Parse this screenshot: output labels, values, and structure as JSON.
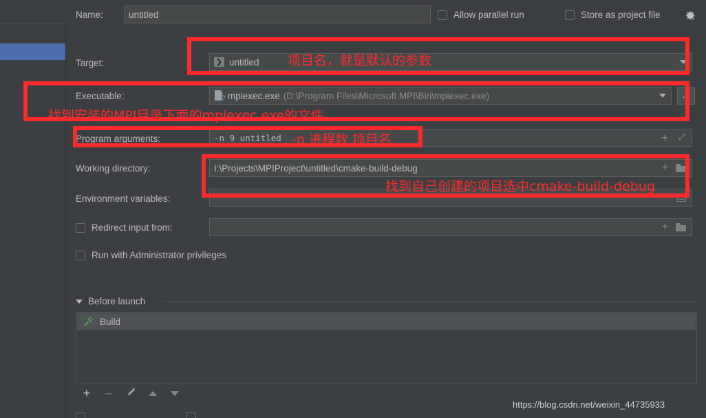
{
  "window": {
    "theme_bg": "#3c3f41",
    "accent_selection": "#4b6eaf",
    "annotation_color": "#ff2a2a"
  },
  "form": {
    "name": {
      "label": "Name:",
      "value": "untitled"
    },
    "allow_parallel_run": {
      "label": "Allow parallel run",
      "checked": false
    },
    "store_as_project_file": {
      "label": "Store as project file",
      "checked": false
    },
    "gear_icon": "gear-icon",
    "target": {
      "label": "Target:",
      "value": "untitled",
      "icon": "run-configuration-icon"
    },
    "executable": {
      "label": "Executable:",
      "value": "mpiexec.exe",
      "path": "(D:\\Program Files\\Microsoft MPI\\Bin\\mpiexec.exe)",
      "icon": "unknown-file-icon",
      "browse_label": "..."
    },
    "program_arguments": {
      "label": "Program arguments:",
      "value": "-n 9 untitled",
      "expand_icon": "expand-icon",
      "insert_icon": "insert-macro-icon"
    },
    "working_directory": {
      "label": "Working directory:",
      "value": "I:\\Projects\\MPIProject\\untitled\\cmake-build-debug",
      "folder_icon": "folder-icon",
      "insert_icon": "insert-macro-icon"
    },
    "environment_variables": {
      "label": "Environment variables:",
      "value": "",
      "browse_icon": "env-browse-icon"
    },
    "redirect_input_from": {
      "label": "Redirect input from:",
      "checked": false,
      "value": "",
      "folder_icon": "folder-icon",
      "insert_icon": "insert-macro-icon"
    },
    "run_with_admin": {
      "label": "Run with Administrator privileges",
      "checked": false
    }
  },
  "before_launch": {
    "title": "Before launch",
    "collapse_icon": "triangle-down-icon",
    "items": [
      {
        "label": "Build",
        "icon": "hammer-icon"
      }
    ],
    "toolbar": {
      "add": "+",
      "remove": "–",
      "edit": "pencil-icon",
      "move_up": "triangle-up-icon",
      "move_down": "triangle-down-icon"
    }
  },
  "annotations": [
    {
      "id": "target-note",
      "text": "项目名，就是默认的参数"
    },
    {
      "id": "executable-note",
      "text": "找到安装的MPI目录下面的mpiexec.exe的文件"
    },
    {
      "id": "args-note",
      "text": "-n 进程数 项目名"
    },
    {
      "id": "workdir-note",
      "text": "找到自己创建的项目选中cmake-build-debug"
    }
  ],
  "watermark": {
    "text": "https://blog.csdn.net/weixin_44735933"
  }
}
